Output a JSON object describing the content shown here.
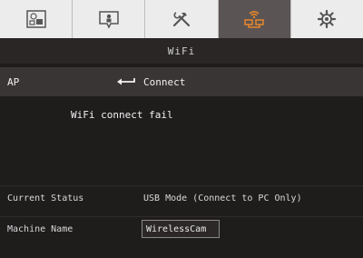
{
  "tabs": [
    {
      "icon": "picture-settings-icon"
    },
    {
      "icon": "display-person-icon"
    },
    {
      "icon": "tools-icon"
    },
    {
      "icon": "wifi-network-icon"
    },
    {
      "icon": "gear-icon"
    }
  ],
  "active_tab": 3,
  "colors": {
    "accent": "#e7872b",
    "active_tab_bg": "#5b5454"
  },
  "page": {
    "title": "WiFi"
  },
  "ap_row": {
    "label": "AP",
    "action": "Connect"
  },
  "message": "WiFi connect fail",
  "current_status": {
    "label": "Current Status",
    "value": "USB Mode (Connect to PC Only)"
  },
  "machine_name": {
    "label": "Machine Name",
    "value": "WirelessCam"
  }
}
